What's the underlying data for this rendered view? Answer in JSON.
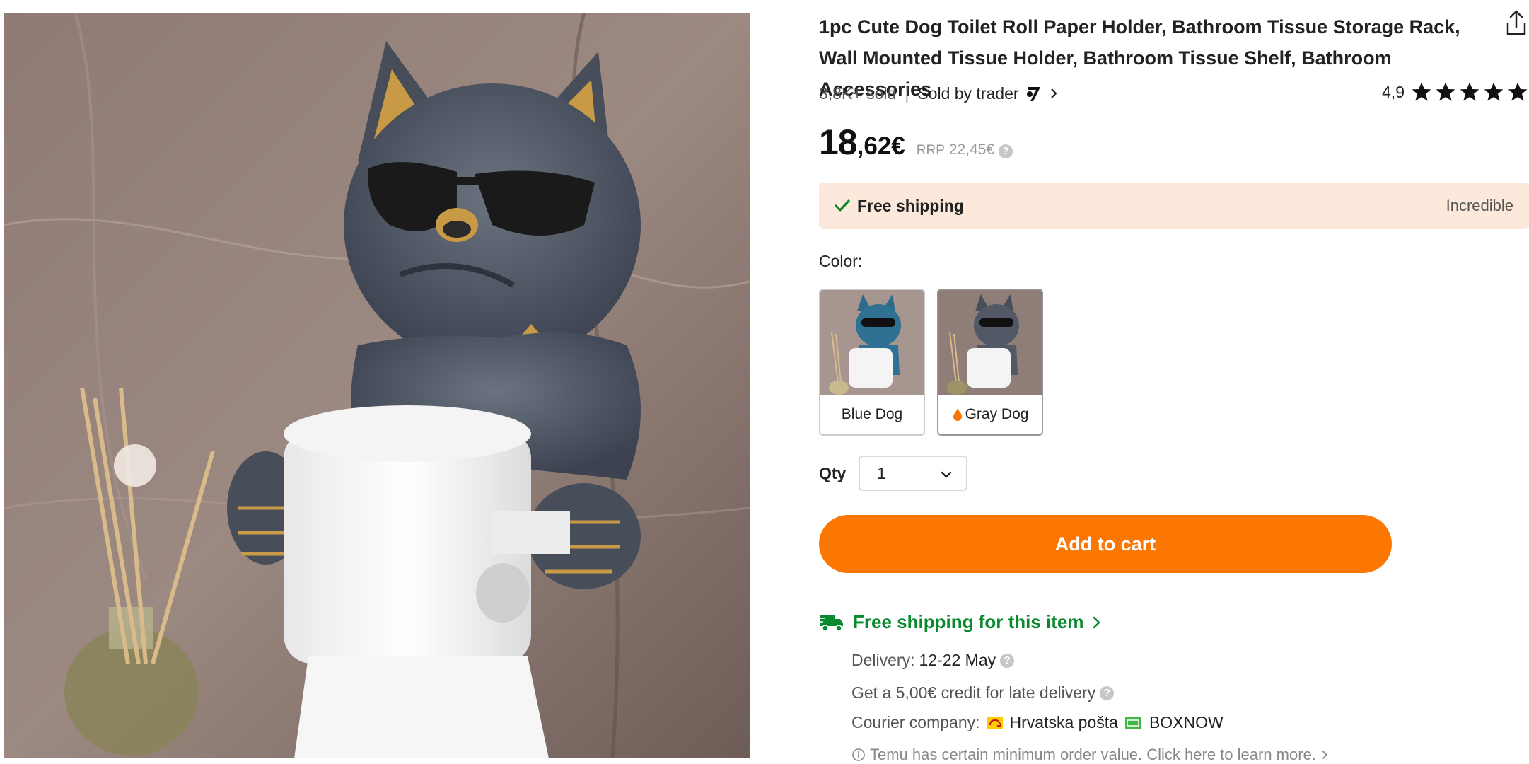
{
  "product": {
    "title": "1pc Cute Dog Toilet Roll Paper Holder, Bathroom Tissue Storage Rack, Wall Mounted Tissue Holder, Bathroom Tissue Shelf, Bathroom Accessories",
    "sold": "3,8K+ sold",
    "separator": "|",
    "sold_by": "Sold by trader",
    "rating": "4,9",
    "stars": 5
  },
  "price": {
    "integer": "18",
    "decimal": ",62€",
    "rrp_label": "RRP",
    "rrp_value": "22,45€",
    "info": "?"
  },
  "shipping_banner": {
    "label": "Free shipping",
    "tag": "Incredible"
  },
  "color": {
    "label": "Color:",
    "options": [
      {
        "name": "Blue Dog",
        "selected": false
      },
      {
        "name": "Gray Dog",
        "selected": true
      }
    ]
  },
  "quantity": {
    "label": "Qty",
    "value": "1"
  },
  "cart": {
    "button_label": "Add to cart"
  },
  "delivery": {
    "heading": "Free shipping for this item",
    "delivery_label": "Delivery:",
    "delivery_value": "12-22 May",
    "credit_text": "Get a 5,00€ credit for late delivery",
    "courier_label": "Courier company:",
    "courier_1": "Hrvatska pošta",
    "courier_2": "BOXNOW",
    "min_order_text": "Temu has certain minimum order value. Click here to learn more."
  },
  "colors": {
    "accent_orange": "#fb7701",
    "shipping_green": "#0a8a2e",
    "banner_bg": "#fde9dc"
  },
  "icons": [
    "share-icon",
    "trader-logo-icon",
    "chevron-right-icon",
    "star-icon",
    "check-icon",
    "hot-icon",
    "chevron-down-icon",
    "truck-icon",
    "help-icon",
    "info-icon",
    "post-horn-icon",
    "parcel-icon"
  ]
}
